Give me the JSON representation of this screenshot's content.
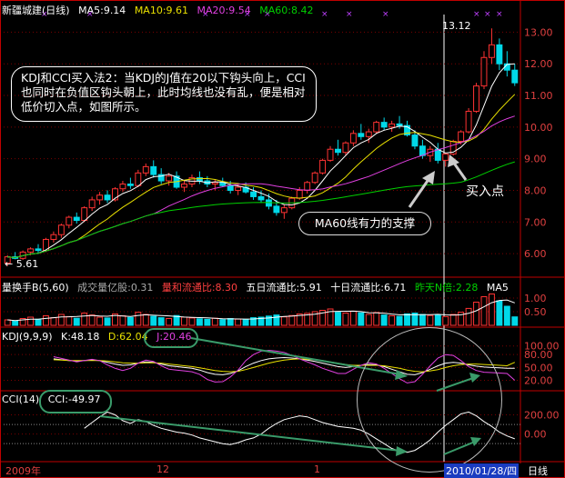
{
  "header": {
    "stock": "新疆城建(日线)",
    "ma5": "MA5:9.14",
    "ma10": "MA10:9.61",
    "ma20": "MA20:9.54",
    "ma60": "MA60:8.42"
  },
  "colors": {
    "up": "#ff3333",
    "down": "#00d8e8",
    "ma5": "#ffffff",
    "ma10": "#e8e000",
    "ma20": "#e040e0",
    "ma60": "#00d000",
    "axis": "#c00000",
    "grid": "#7a0000"
  },
  "annotation": {
    "text": "KDJ和CCI买入法2：当KDJ的J值在20以下钩头向上，CCI也同时在负值区钩头朝上，此时均线也没有乱，便是相对低价切入点，如图所示。",
    "buy_point": "买入点",
    "ma60_support": "MA60线有力的支撑",
    "high_label": "13.12",
    "low_label": "← 5.61"
  },
  "volume_header": {
    "title": "量换手B(5,60)",
    "vol": "成交量亿股:0.31",
    "circ": "量和流通比:8.30",
    "five": "五日流通比:5.91",
    "ten": "十日流通比:6.71",
    "yest": "昨天N倍:2.28",
    "ma": "MA5"
  },
  "kdj_header": {
    "title": "KDJ(9,9,9)",
    "k": "K:48.18",
    "d": "D:62.04",
    "j": "J:20.46"
  },
  "cci_header": {
    "title": "CCI(14)",
    "cci": "CCI:-49.97"
  },
  "footer": {
    "year": "2009年",
    "m12": "12",
    "m1": "1",
    "date": "2010/01/28/四",
    "period": "日线"
  },
  "chart_data": {
    "type": "candlestick",
    "price_ylim": [
      5.4,
      13.5
    ],
    "price_ticks": [
      "13.00",
      "12.00",
      "11.00",
      "10.00",
      "9.00",
      "8.00",
      "7.00",
      "6.00"
    ],
    "volume_ticks": [
      "1.00",
      "0.50"
    ],
    "kdj_ticks": [
      "100.00",
      "80.00",
      "50.00",
      "20.00"
    ],
    "cci_ticks": [
      "200.00",
      "0.00"
    ],
    "candles": [
      [
        5.7,
        5.95,
        5.61,
        5.9
      ],
      [
        5.9,
        6.05,
        5.82,
        5.85
      ],
      [
        5.85,
        6.1,
        5.8,
        6.05
      ],
      [
        6.05,
        6.2,
        5.95,
        6.15
      ],
      [
        6.15,
        6.3,
        6.0,
        6.1
      ],
      [
        6.1,
        6.5,
        6.05,
        6.45
      ],
      [
        6.45,
        6.7,
        6.35,
        6.6
      ],
      [
        6.6,
        6.95,
        6.5,
        6.9
      ],
      [
        6.9,
        7.2,
        6.8,
        7.15
      ],
      [
        7.15,
        7.3,
        6.95,
        7.05
      ],
      [
        7.05,
        7.5,
        7.0,
        7.45
      ],
      [
        7.45,
        7.8,
        7.35,
        7.7
      ],
      [
        7.7,
        7.95,
        7.55,
        7.85
      ],
      [
        7.85,
        8.0,
        7.6,
        7.7
      ],
      [
        7.7,
        8.1,
        7.65,
        8.05
      ],
      [
        8.05,
        8.3,
        7.95,
        8.2
      ],
      [
        8.2,
        8.4,
        8.05,
        8.15
      ],
      [
        8.15,
        8.65,
        8.1,
        8.55
      ],
      [
        8.55,
        8.85,
        8.45,
        8.75
      ],
      [
        8.75,
        8.95,
        8.4,
        8.5
      ],
      [
        8.5,
        8.7,
        8.2,
        8.3
      ],
      [
        8.3,
        8.55,
        8.15,
        8.45
      ],
      [
        8.45,
        8.6,
        8.05,
        8.1
      ],
      [
        8.1,
        8.3,
        7.95,
        8.2
      ],
      [
        8.2,
        8.5,
        8.1,
        8.4
      ],
      [
        8.4,
        8.6,
        8.2,
        8.3
      ],
      [
        8.3,
        8.45,
        8.1,
        8.2
      ],
      [
        8.2,
        8.35,
        8.0,
        8.25
      ],
      [
        8.25,
        8.4,
        8.1,
        8.15
      ],
      [
        8.15,
        8.3,
        7.9,
        8.0
      ],
      [
        8.0,
        8.2,
        7.85,
        8.1
      ],
      [
        8.1,
        8.25,
        7.9,
        7.95
      ],
      [
        7.95,
        8.1,
        7.7,
        7.8
      ],
      [
        7.8,
        8.0,
        7.6,
        7.7
      ],
      [
        7.7,
        7.9,
        7.4,
        7.5
      ],
      [
        7.5,
        7.7,
        7.2,
        7.3
      ],
      [
        7.3,
        7.55,
        7.1,
        7.45
      ],
      [
        7.45,
        7.8,
        7.4,
        7.75
      ],
      [
        7.75,
        8.1,
        7.7,
        8.0
      ],
      [
        8.0,
        8.3,
        7.9,
        8.25
      ],
      [
        8.25,
        8.6,
        8.2,
        8.55
      ],
      [
        8.55,
        9.0,
        8.5,
        8.95
      ],
      [
        8.95,
        9.4,
        8.9,
        9.3
      ],
      [
        9.3,
        9.6,
        9.1,
        9.2
      ],
      [
        9.2,
        9.55,
        9.1,
        9.5
      ],
      [
        9.5,
        9.9,
        9.4,
        9.8
      ],
      [
        9.8,
        10.1,
        9.6,
        9.7
      ],
      [
        9.7,
        9.95,
        9.5,
        9.85
      ],
      [
        9.85,
        10.2,
        9.8,
        10.15
      ],
      [
        10.15,
        10.3,
        9.9,
        10.0
      ],
      [
        10.0,
        10.2,
        9.85,
        10.1
      ],
      [
        10.1,
        10.35,
        9.95,
        10.05
      ],
      [
        10.05,
        10.2,
        9.7,
        9.75
      ],
      [
        9.75,
        9.9,
        9.3,
        9.4
      ],
      [
        9.4,
        9.6,
        9.0,
        9.1
      ],
      [
        9.1,
        9.4,
        8.9,
        9.3
      ],
      [
        9.3,
        9.5,
        8.85,
        8.95
      ],
      [
        8.95,
        9.2,
        8.75,
        9.15
      ],
      [
        9.15,
        9.6,
        9.1,
        9.55
      ],
      [
        9.55,
        9.9,
        9.45,
        9.85
      ],
      [
        9.85,
        10.6,
        9.8,
        10.5
      ],
      [
        10.5,
        11.4,
        10.45,
        11.3
      ],
      [
        11.3,
        12.4,
        11.2,
        12.2
      ],
      [
        12.2,
        13.12,
        12.0,
        12.6
      ],
      [
        12.6,
        12.8,
        11.8,
        12.0
      ],
      [
        12.0,
        12.4,
        11.6,
        11.8
      ],
      [
        11.8,
        12.0,
        11.3,
        11.4
      ]
    ],
    "volume": [
      0.2,
      0.15,
      0.25,
      0.3,
      0.22,
      0.35,
      0.28,
      0.4,
      0.32,
      0.26,
      0.45,
      0.38,
      0.3,
      0.27,
      0.42,
      0.35,
      0.29,
      0.48,
      0.4,
      0.33,
      0.28,
      0.25,
      0.36,
      0.3,
      0.27,
      0.24,
      0.22,
      0.26,
      0.21,
      0.25,
      0.23,
      0.2,
      0.28,
      0.3,
      0.34,
      0.38,
      0.31,
      0.36,
      0.42,
      0.44,
      0.5,
      0.55,
      0.6,
      0.48,
      0.45,
      0.52,
      0.46,
      0.4,
      0.47,
      0.38,
      0.35,
      0.33,
      0.42,
      0.45,
      0.4,
      0.36,
      0.38,
      0.32,
      0.4,
      0.48,
      0.62,
      0.85,
      1.05,
      1.15,
      0.9,
      0.7,
      0.31
    ],
    "kdj": {
      "K": [
        70,
        68,
        66,
        65,
        66,
        67,
        66,
        62,
        58,
        55,
        56,
        60,
        63,
        62,
        58,
        54,
        52,
        50,
        48,
        44,
        38,
        34,
        33,
        36,
        42,
        52,
        60,
        66,
        70,
        72,
        73,
        72,
        70,
        67,
        64,
        60,
        56,
        52,
        50,
        52,
        55,
        57,
        56,
        52,
        46,
        40,
        34,
        33,
        38,
        46,
        54,
        60,
        62,
        60,
        56,
        53,
        51,
        50,
        49,
        48,
        48
      ],
      "D": [
        68,
        67,
        66,
        66,
        66,
        66,
        66,
        65,
        63,
        61,
        60,
        60,
        61,
        61,
        60,
        58,
        56,
        54,
        52,
        49,
        46,
        43,
        41,
        40,
        41,
        45,
        50,
        55,
        60,
        64,
        67,
        69,
        70,
        69,
        68,
        66,
        63,
        60,
        57,
        55,
        55,
        55,
        55,
        54,
        51,
        48,
        44,
        41,
        40,
        42,
        45,
        50,
        54,
        57,
        58,
        58,
        57,
        56,
        55,
        54,
        62
      ],
      "J": [
        75,
        71,
        67,
        63,
        66,
        69,
        66,
        56,
        48,
        43,
        48,
        60,
        67,
        64,
        54,
        46,
        44,
        42,
        40,
        34,
        22,
        16,
        17,
        28,
        44,
        66,
        80,
        88,
        90,
        88,
        85,
        78,
        70,
        63,
        56,
        48,
        42,
        36,
        36,
        46,
        55,
        61,
        58,
        48,
        36,
        24,
        14,
        17,
        34,
        54,
        72,
        80,
        78,
        66,
        52,
        43,
        39,
        38,
        37,
        36,
        20
      ]
    },
    "cci": [
      60,
      120,
      180,
      230,
      200,
      140,
      110,
      150,
      130,
      90,
      60,
      40,
      20,
      10,
      -10,
      -40,
      -60,
      -80,
      -100,
      -110,
      -90,
      -60,
      -40,
      0,
      60,
      110,
      150,
      170,
      190,
      180,
      150,
      120,
      100,
      80,
      70,
      60,
      40,
      0,
      -50,
      -100,
      -150,
      -180,
      -190,
      -170,
      -120,
      -60,
      20,
      90,
      150,
      210,
      230,
      190,
      130,
      80,
      20,
      -20,
      -49.97
    ]
  }
}
